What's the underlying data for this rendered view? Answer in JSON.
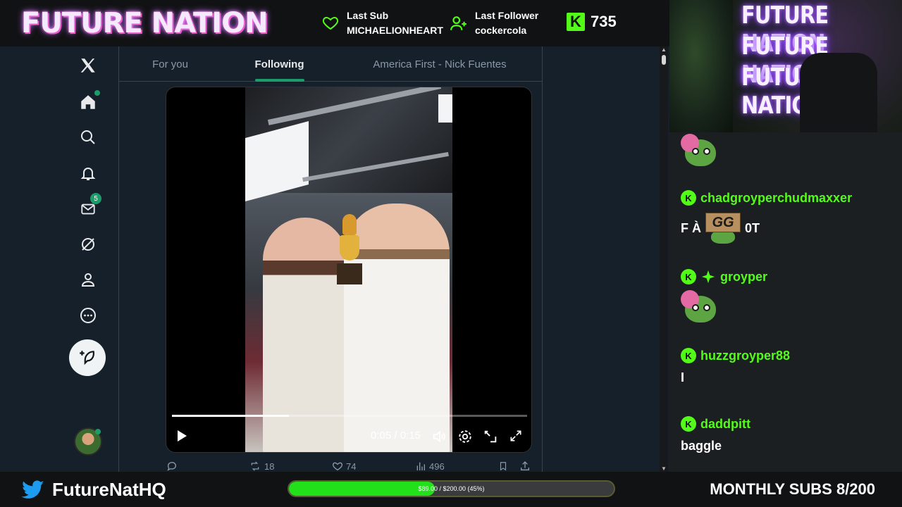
{
  "overlay": {
    "brand": "FUTURE NATION",
    "last_sub": {
      "label": "Last Sub",
      "value": "MICHAELIONHEART"
    },
    "last_follower": {
      "label": "Last Follower",
      "value": "cockercola"
    },
    "kick_viewers": "735",
    "accent": "#53fc18"
  },
  "twitter": {
    "tabs": [
      "For you",
      "Following",
      "America First - Nick Fuentes"
    ],
    "active_tab": "Following",
    "messages_badge": "5",
    "video": {
      "time": "0:05 / 0:15",
      "progress": 0.33
    },
    "actions": {
      "replies": "",
      "reposts": "18",
      "likes": "74",
      "views": "496"
    }
  },
  "webcam": {
    "sign_lines": [
      "FUTURE NATION",
      "FUTURE NATION",
      "FUTURE NATION"
    ]
  },
  "chat": {
    "messages": [
      {
        "user": "",
        "text": ""
      },
      {
        "user": "chadgroyperchudmaxxer",
        "text_before": "F À",
        "emote": "GG",
        "text_after": "0T"
      },
      {
        "user": "groyper",
        "text": ""
      },
      {
        "user": "huzzgroyper88",
        "text": "I"
      },
      {
        "user": "daddpitt",
        "text": "baggle"
      }
    ]
  },
  "bottom": {
    "handle": "FutureNatHQ",
    "goal_text": "$89.00 / $200.00 (45%)",
    "goal_progress": 0.45,
    "monthly_subs": "MONTHLY SUBS 8/200"
  }
}
